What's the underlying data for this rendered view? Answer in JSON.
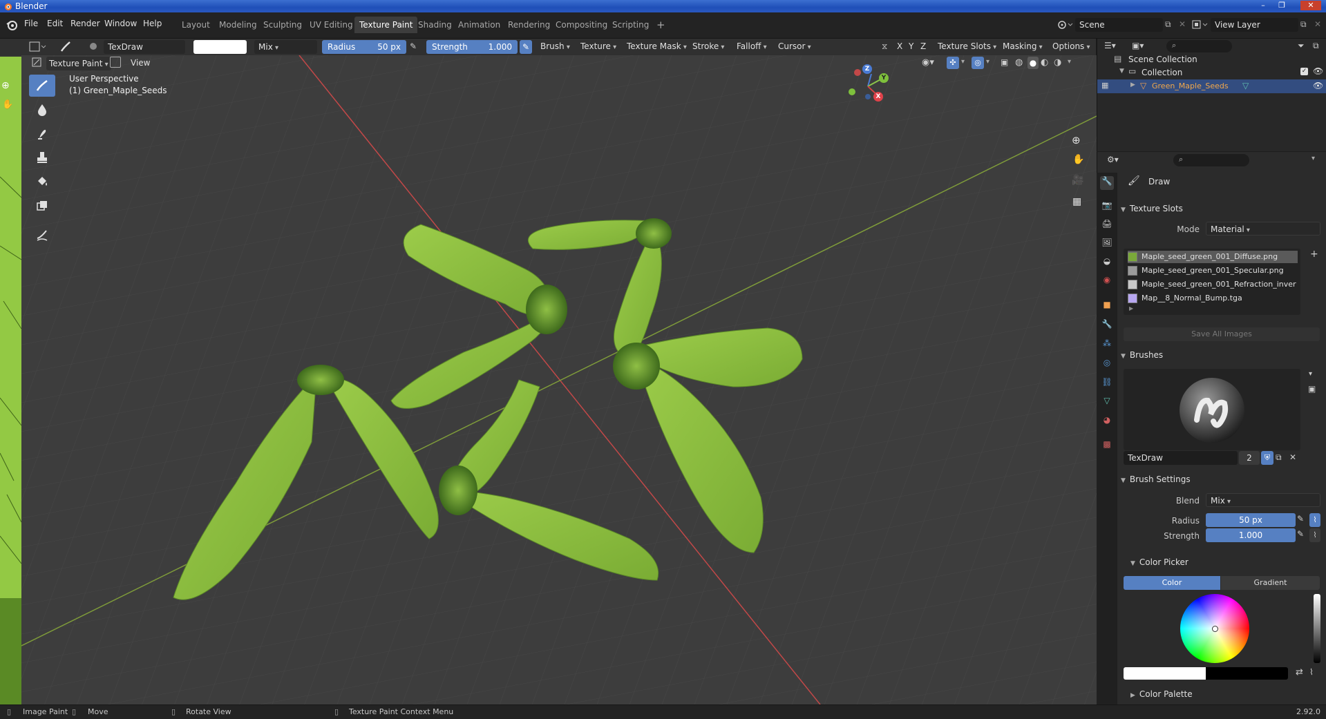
{
  "window": {
    "title": "Blender",
    "controls": [
      "–",
      "❐",
      "✕"
    ]
  },
  "menus": [
    "File",
    "Edit",
    "Render",
    "Window",
    "Help"
  ],
  "workspaces": [
    "Layout",
    "Modeling",
    "Sculpting",
    "UV Editing",
    "Texture Paint",
    "Shading",
    "Animation",
    "Rendering",
    "Compositing",
    "Scripting",
    "+"
  ],
  "active_workspace": "Texture Paint",
  "scene": {
    "name": "Scene",
    "view_layer": "View Layer"
  },
  "toolheader": {
    "brush_name": "TexDraw",
    "blend": "Mix",
    "radius_label": "Radius",
    "radius_value": "50 px",
    "strength_label": "Strength",
    "strength_value": "1.000",
    "strength_fraction": 1.0,
    "menus": [
      "Brush",
      "Texture",
      "Texture Mask",
      "Stroke",
      "Falloff",
      "Cursor"
    ],
    "axes": [
      "X",
      "Y",
      "Z"
    ],
    "right_menus": [
      "Texture Slots",
      "Masking",
      "Options"
    ]
  },
  "viewport": {
    "mode": "Texture Paint",
    "view_menu": "View",
    "overlay_line1": "User Perspective",
    "overlay_line2": "(1) Green_Maple_Seeds",
    "gizmo_labels": [
      "Z",
      "Y",
      "X"
    ]
  },
  "outliner": {
    "root": "Scene Collection",
    "collection": "Collection",
    "object": "Green_Maple_Seeds"
  },
  "properties": {
    "active_tool": "Draw",
    "texture_slots": {
      "title": "Texture Slots",
      "mode_label": "Mode",
      "mode_value": "Material",
      "slots": [
        {
          "name": "Maple_seed_green_001_Diffuse.png",
          "color": "#7aa83a",
          "selected": true
        },
        {
          "name": "Maple_seed_green_001_Specular.png",
          "color": "#9a9a9a",
          "selected": false
        },
        {
          "name": "Maple_seed_green_001_Refraction_invert...",
          "color": "#c8c8c8",
          "selected": false
        },
        {
          "name": "Map__8_Normal_Bump.tga",
          "color": "#b7a7f0",
          "selected": false
        }
      ],
      "save_button": "Save All Images"
    },
    "brushes": {
      "title": "Brushes",
      "brush_name": "TexDraw",
      "users": "2"
    },
    "brush_settings": {
      "title": "Brush Settings",
      "blend_label": "Blend",
      "blend_value": "Mix",
      "radius_label": "Radius",
      "radius_value": "50 px",
      "strength_label": "Strength",
      "strength_value": "1.000",
      "color_picker": "Color Picker",
      "tab_color": "Color",
      "tab_gradient": "Gradient",
      "color_palette": "Color Palette"
    }
  },
  "statusbar": {
    "items": [
      "Image Paint",
      "Move",
      "Rotate View",
      "Texture Paint Context Menu"
    ],
    "version": "2.92.0"
  },
  "colors": {
    "accent": "#5680c2",
    "viewport_bg": "#3d3d3d",
    "seed_green": "#8ab83c",
    "x_axis": "#d04545",
    "y_axis": "#8bc34a"
  }
}
